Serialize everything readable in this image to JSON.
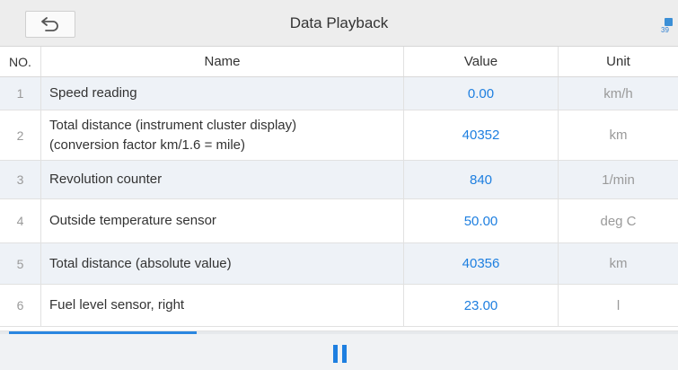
{
  "header": {
    "title": "Data Playback",
    "back_icon": "back-arrow-icon",
    "status_percent": "39"
  },
  "table": {
    "columns": {
      "no": "NO.",
      "name": "Name",
      "value": "Value",
      "unit": "Unit"
    },
    "rows": [
      {
        "no": "1",
        "name": "Speed reading",
        "value": "0.00",
        "unit": "km/h"
      },
      {
        "no": "2",
        "name_line1": "Total distance (instrument cluster display)",
        "name_line2": "(conversion factor km/1.6 = mile)",
        "value": "40352",
        "unit": "km"
      },
      {
        "no": "3",
        "name": "Revolution counter",
        "value": "840",
        "unit": "1/min"
      },
      {
        "no": "4",
        "name": "Outside temperature sensor",
        "value": "50.00",
        "unit": "deg C"
      },
      {
        "no": "5",
        "name": "Total distance (absolute value)",
        "value": "40356",
        "unit": "km"
      },
      {
        "no": "6",
        "name": "Fuel level sensor, right",
        "value": "23.00",
        "unit": "l"
      }
    ]
  },
  "footer": {
    "playback_progress": 0.29,
    "pause_icon": "pause-icon"
  },
  "colors": {
    "accent": "#1e7fe0",
    "header_bg": "#ededed",
    "alt_row_bg": "#eef2f7"
  }
}
